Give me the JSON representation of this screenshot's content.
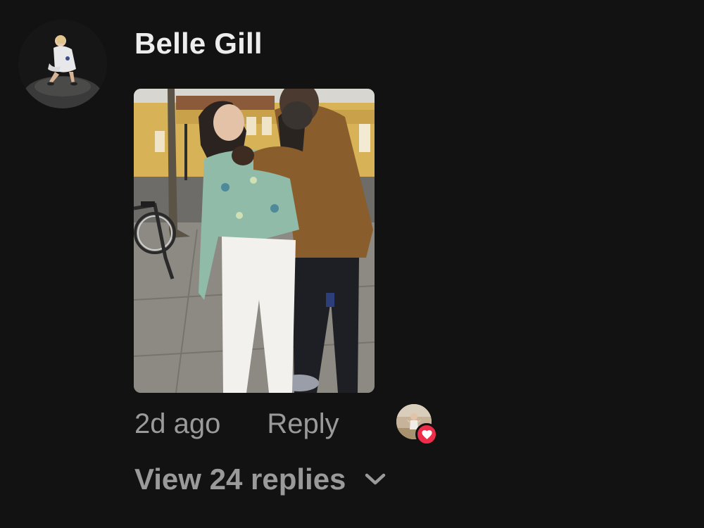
{
  "comment": {
    "author": {
      "name": "Belle Gill",
      "avatar_icon": "profile-photo"
    },
    "attachment": {
      "type": "photo",
      "icon": "photo-attachment"
    },
    "timestamp": "2d ago",
    "reply_label": "Reply",
    "liked_by": {
      "avatar_icon": "liker-profile-photo",
      "reaction_icon": "heart-icon",
      "reaction_color": "#ed2d4a"
    },
    "replies": {
      "label": "View 24 replies",
      "icon": "chevron-down-icon"
    }
  },
  "colors": {
    "background": "#121212",
    "primary_text": "#ededed",
    "secondary_text": "#9a9a9a"
  }
}
